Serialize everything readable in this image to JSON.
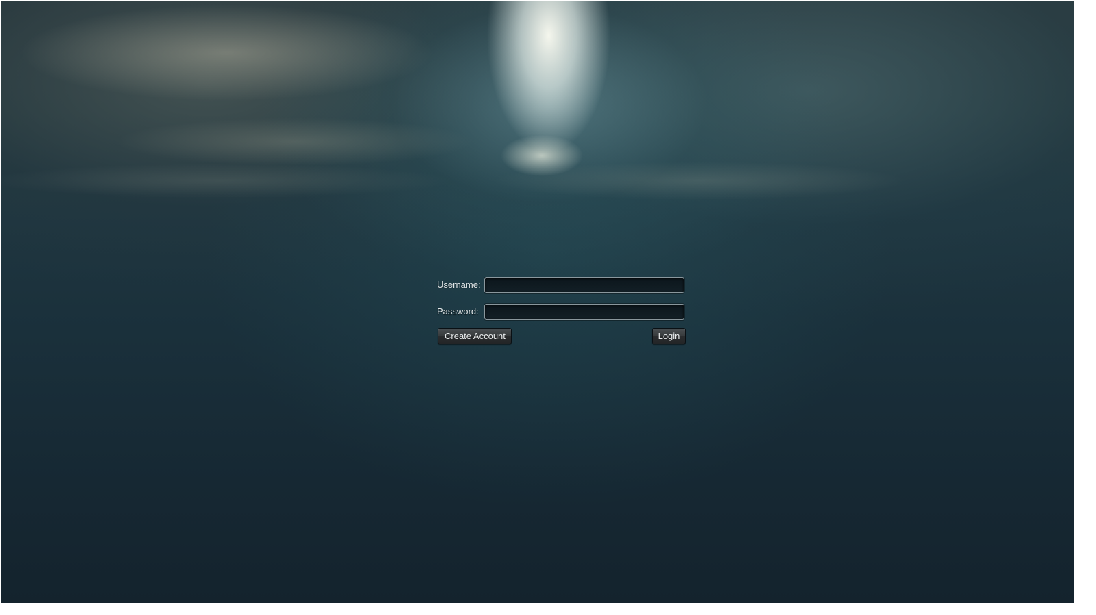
{
  "login": {
    "username_label": "Username:",
    "username_value": "",
    "password_label": "Password:",
    "password_value": "",
    "create_account_label": "Create Account",
    "login_label": "Login"
  },
  "colors": {
    "background_dark": "#172a34",
    "cloud_highlight": "#fffff5",
    "field_background": "#0c161c",
    "field_border": "#8a979d",
    "button_background": "#36393b",
    "text": "#e6ecee"
  }
}
